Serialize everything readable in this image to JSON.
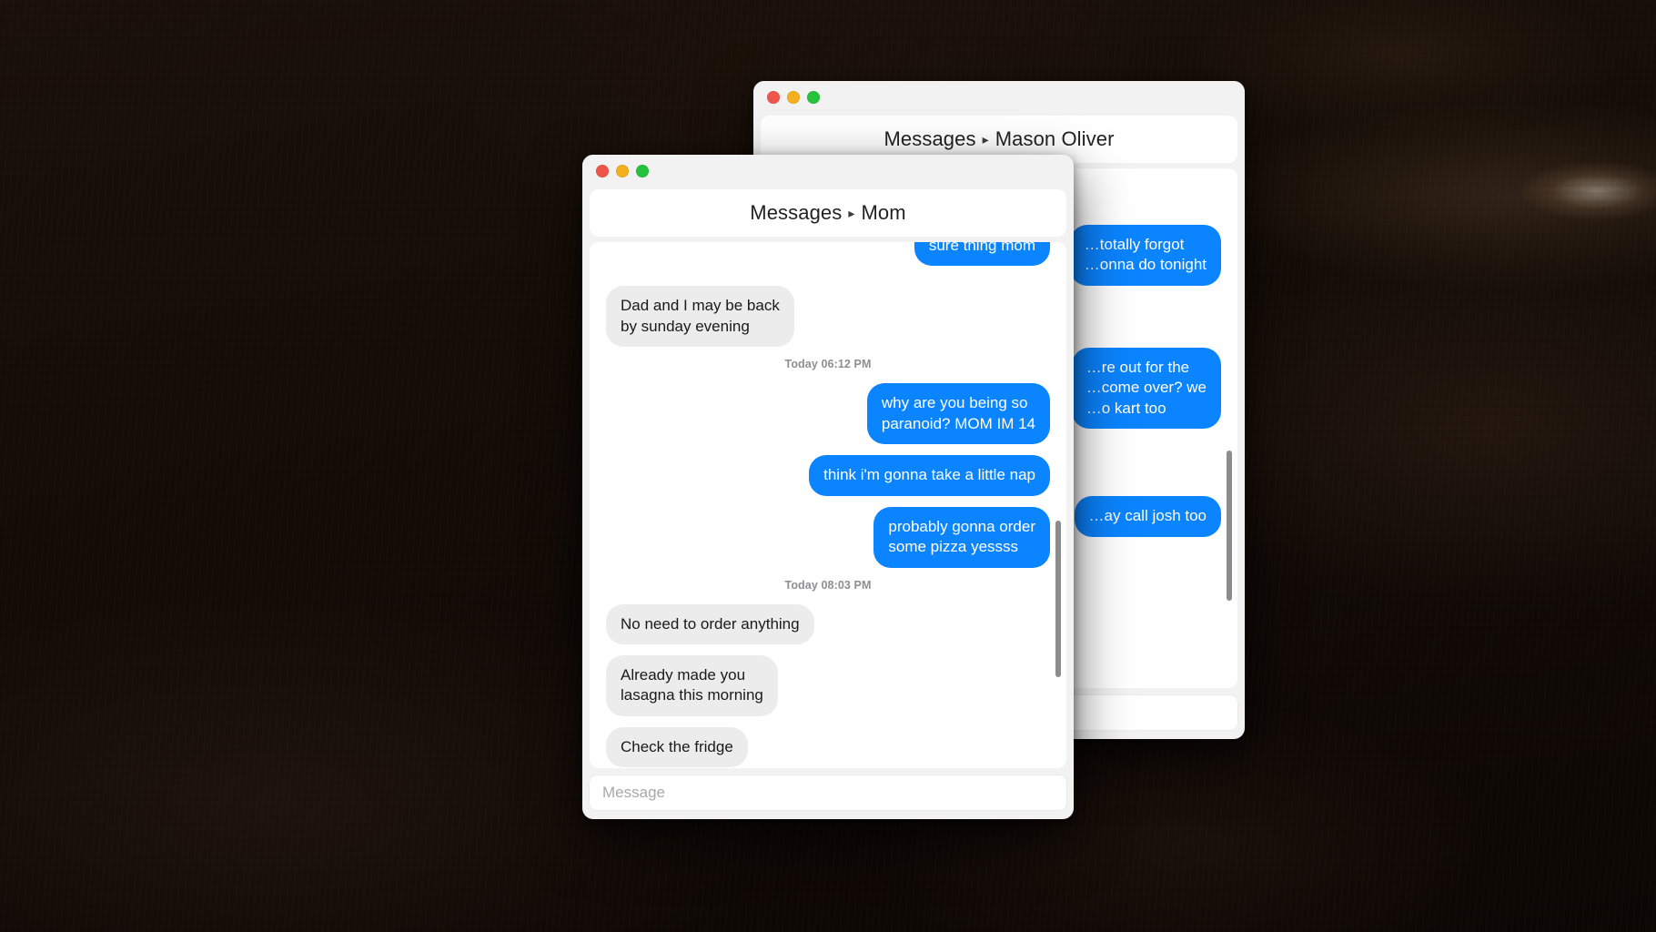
{
  "desktop": {
    "background_color": "#130c08"
  },
  "theme": {
    "bubble_outgoing_color": "#0b84ff",
    "bubble_incoming_color": "#ececed",
    "window_chrome_color": "#f2f2f2",
    "timestamp_color": "#8e8e93",
    "traffic_red": "#ee564b",
    "traffic_yellow": "#f2b01f",
    "traffic_green": "#25c33b"
  },
  "windows": {
    "back": {
      "app_name": "Messages",
      "separator": "▸",
      "contact": "Mason Oliver",
      "composer_placeholder": "",
      "messages": [
        {
          "direction": "out",
          "text": "…totally forgot\n…onna do tonight"
        },
        {
          "direction": "out",
          "text": "…re out for the\n…come over? we\n…o kart too"
        },
        {
          "direction": "out",
          "text": "…ay call josh too"
        }
      ]
    },
    "front": {
      "app_name": "Messages",
      "separator": "▸",
      "contact": "Mom",
      "composer_placeholder": "Message",
      "messages": [
        {
          "type": "bubble",
          "direction": "out",
          "text": "sure thing mom"
        },
        {
          "type": "bubble",
          "direction": "in",
          "text": "Dad and I may be back\nby sunday evening"
        },
        {
          "type": "timestamp",
          "text": "Today 06:12 PM"
        },
        {
          "type": "bubble",
          "direction": "out",
          "text": "why are you being so\nparanoid? MOM IM 14"
        },
        {
          "type": "bubble",
          "direction": "out",
          "text": "think i'm gonna take a little nap"
        },
        {
          "type": "bubble",
          "direction": "out",
          "text": "probably gonna order\nsome pizza yessss"
        },
        {
          "type": "timestamp",
          "text": "Today 08:03 PM"
        },
        {
          "type": "bubble",
          "direction": "in",
          "text": "No need to order anything"
        },
        {
          "type": "bubble",
          "direction": "in",
          "text": "Already made you\nlasagna this morning"
        },
        {
          "type": "bubble",
          "direction": "in",
          "text": "Check the fridge"
        }
      ]
    }
  }
}
